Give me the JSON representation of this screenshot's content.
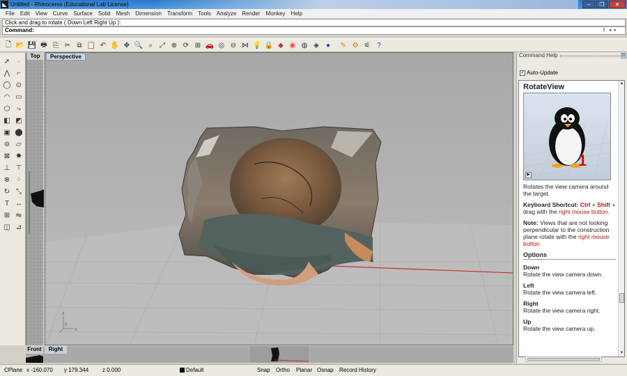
{
  "window": {
    "title": "Untitled - Rhinoceros (Educational Lab License)",
    "controls": [
      "minimize",
      "maximize",
      "close"
    ]
  },
  "menu": [
    "File",
    "Edit",
    "View",
    "Curve",
    "Surface",
    "Solid",
    "Mesh",
    "Dimension",
    "Transform",
    "Tools",
    "Analyze",
    "Render",
    "Monkey",
    "Help"
  ],
  "command": {
    "history": "Click and drag to rotate ( Down  Left  Right  Up ):",
    "prompt_label": "Command:",
    "value": ""
  },
  "toolbar_icons": [
    "new-icon",
    "open-icon",
    "save-icon",
    "print-icon",
    "import-icon",
    "cut-icon",
    "copy-icon",
    "paste-icon",
    "undo-icon",
    "pan-icon",
    "move-view-icon",
    "zoom-in-icon",
    "zoom-window-icon",
    "zoom-extents-icon",
    "zoom-selected-icon",
    "rotate-view-icon",
    "four-views-icon",
    "car-icon",
    "camera-icon",
    "cplane-icon",
    "select-icon",
    "light-icon",
    "lock-icon",
    "layer-icon",
    "color-wheel-icon",
    "shade-icon",
    "render-icon",
    "sphere-icon",
    "pen-icon",
    "gear-icon",
    "options-icon",
    "help-icon"
  ],
  "viewports": {
    "top": "Top",
    "perspective": "Perspective",
    "front": "Front",
    "right": "Right",
    "axis_labels": {
      "x": "x",
      "y": "y",
      "z": "z"
    }
  },
  "help_panel": {
    "header": "Command Help",
    "auto_update_label": "Auto-Update",
    "auto_update_checked": true,
    "command_name": "RotateView",
    "description": "Rotates the view camera around the target.",
    "shortcut": {
      "label": "Keyboard Shortcut:",
      "key1": "Ctrl",
      "plus1": "+",
      "key2": "Shift",
      "rest": "+ drag with the",
      "link": "right mouse button",
      "end": "."
    },
    "note": {
      "label": "Note:",
      "text": "Views that are not looking perpendicular to the construction plane rotate with the",
      "link": "right mouse button",
      "end": "."
    },
    "options_heading": "Options",
    "options": [
      {
        "name": "Down",
        "desc": "Rotate the view camera down."
      },
      {
        "name": "Left",
        "desc": "Rotate the view camera left."
      },
      {
        "name": "Right",
        "desc": "Rotate the view camera right."
      },
      {
        "name": "Up",
        "desc": "Rotate the view camera up."
      }
    ]
  },
  "status": {
    "cplane": "CPlane",
    "x": "x -160.070",
    "y": "y 179.344",
    "z": "z 0.000",
    "layer": "Default",
    "layer_color": "#000000",
    "toggles": [
      "Snap",
      "Ortho",
      "Planar",
      "Osnap",
      "Record History"
    ]
  }
}
